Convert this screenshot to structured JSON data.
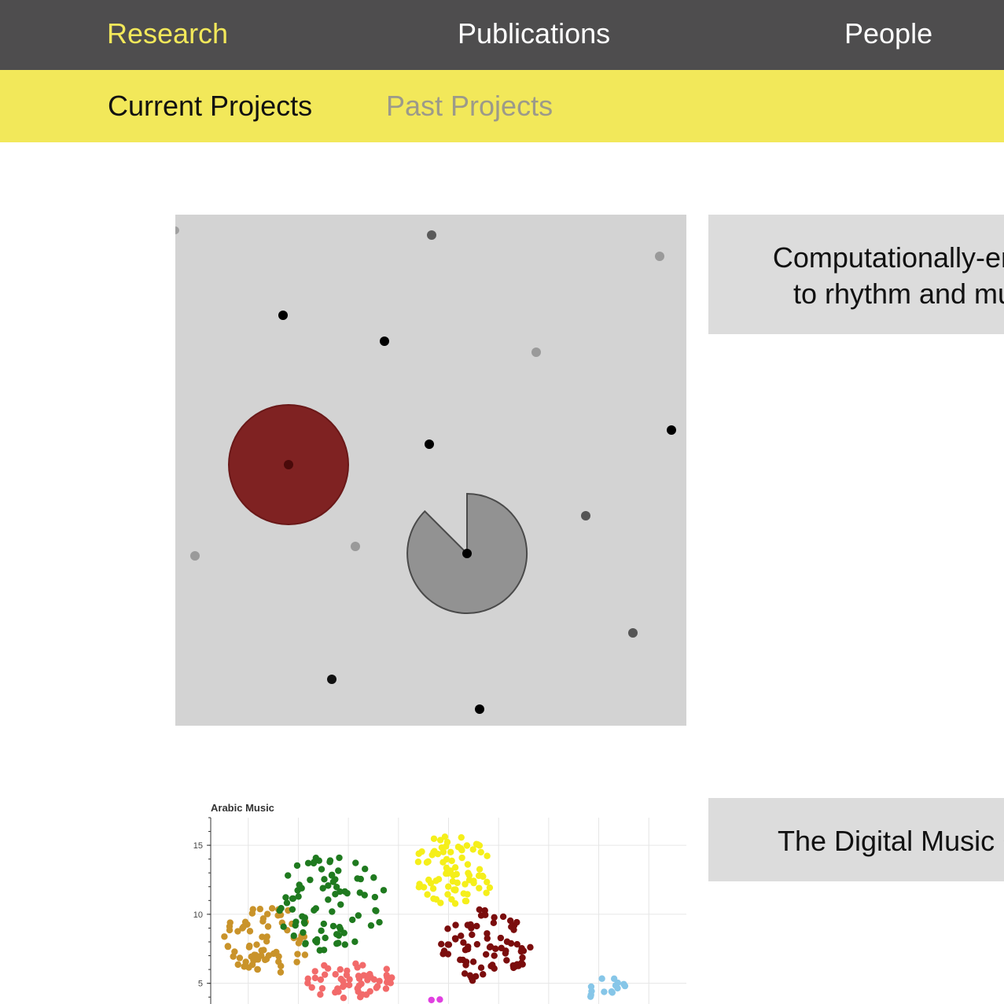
{
  "top_nav": {
    "items": [
      {
        "label": "Research",
        "active": true
      },
      {
        "label": "Publications",
        "active": false
      },
      {
        "label": "People",
        "active": false
      }
    ]
  },
  "sub_nav": {
    "items": [
      {
        "label": "Current Projects",
        "active": true
      },
      {
        "label": "Past Projects",
        "active": false
      }
    ]
  },
  "projects": [
    {
      "title_line1": "Computationally-enga",
      "title_line2": "to rhythm and mus",
      "image": "rhythm-dots-animation"
    },
    {
      "title_line1": "The Digital Music C",
      "image": "arabic-music-scatter-plot"
    }
  ],
  "colors": {
    "nav_bg": "#4e4d4e",
    "accent_yellow": "#f2e85a",
    "title_box_bg": "#dcdcdc",
    "dark_red_circle": "#7f2222"
  },
  "chart_data": {
    "type": "scatter",
    "title": "Arabic Music",
    "xlabel": "",
    "ylabel": "",
    "ylim": [
      3.5,
      17
    ],
    "yticks": [
      "15",
      "10",
      "5"
    ],
    "grid": true,
    "clusters": [
      {
        "color": "#c9932a",
        "cx": 2.3,
        "cy": 8.2,
        "rx": 1.8,
        "ry": 2.5,
        "n": 70
      },
      {
        "color": "#1f7a1f",
        "cx": 4.8,
        "cy": 10.8,
        "rx": 2.2,
        "ry": 3.5,
        "n": 85
      },
      {
        "color": "#f26a6a",
        "cx": 5.6,
        "cy": 5.2,
        "rx": 1.8,
        "ry": 1.4,
        "n": 55
      },
      {
        "color": "#f5ef1a",
        "cx": 9.7,
        "cy": 13.2,
        "rx": 1.7,
        "ry": 2.6,
        "n": 80
      },
      {
        "color": "#7b0d0d",
        "cx": 11.0,
        "cy": 7.8,
        "rx": 1.8,
        "ry": 2.8,
        "n": 75
      },
      {
        "color": "#86c6e8",
        "cx": 15.8,
        "cy": 4.6,
        "rx": 0.8,
        "ry": 1.0,
        "n": 14
      },
      {
        "color": "#e040e0",
        "cx": 9.0,
        "cy": 3.8,
        "rx": 0.2,
        "ry": 0.2,
        "n": 2
      }
    ]
  }
}
